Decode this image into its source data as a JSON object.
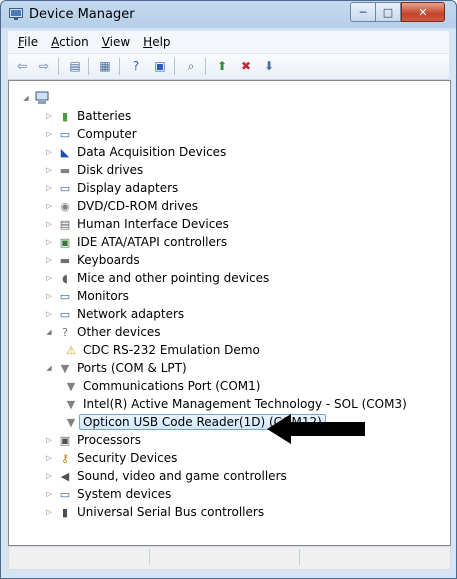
{
  "window": {
    "title": "Device Manager",
    "min": "─",
    "max": "□",
    "close": "✕"
  },
  "menu": [
    {
      "label": "File",
      "hotkey": "F",
      "rest": "ile"
    },
    {
      "label": "Action",
      "hotkey": "A",
      "rest": "ction"
    },
    {
      "label": "View",
      "hotkey": "V",
      "rest": "iew"
    },
    {
      "label": "Help",
      "hotkey": "H",
      "rest": "elp"
    }
  ],
  "toolbar": [
    {
      "name": "back-icon",
      "glyph": "⇦",
      "color": "#5b7aa0"
    },
    {
      "name": "forward-icon",
      "glyph": "⇨",
      "color": "#5b7aa0"
    },
    {
      "name": "show-hide-console-tree-icon",
      "glyph": "▤",
      "color": "#4a6e99"
    },
    {
      "name": "properties-icon",
      "glyph": "▦",
      "color": "#4a6e99"
    },
    {
      "name": "help-icon",
      "glyph": "?",
      "color": "#2b5fb0"
    },
    {
      "name": "help-topics-icon",
      "glyph": "▣",
      "color": "#2b5fb0"
    },
    {
      "name": "scan-hardware-changes-icon",
      "glyph": "⌕",
      "color": "#3d6aa6"
    },
    {
      "name": "update-driver-icon",
      "glyph": "⬆",
      "color": "#2e8b3a"
    },
    {
      "name": "uninstall-icon",
      "glyph": "✖",
      "color": "#c1272d"
    },
    {
      "name": "disable-device-icon",
      "glyph": "⬇",
      "color": "#4a6e99"
    }
  ],
  "tree": {
    "root": {
      "label": ""
    },
    "categories": [
      {
        "label": "Batteries",
        "icon": "battery-icon",
        "glyph": "▮",
        "color": "#4a9a3a"
      },
      {
        "label": "Computer",
        "icon": "computer-icon",
        "glyph": "▭",
        "color": "#2f5f9f"
      },
      {
        "label": "Data Acquisition Devices",
        "icon": "data-acquisition-icon",
        "glyph": "◣",
        "color": "#1a4fb0"
      },
      {
        "label": "Disk drives",
        "icon": "disk-drive-icon",
        "glyph": "▬",
        "color": "#808080"
      },
      {
        "label": "Display adapters",
        "icon": "display-adapter-icon",
        "glyph": "▭",
        "color": "#2f5f9f"
      },
      {
        "label": "DVD/CD-ROM drives",
        "icon": "dvd-drive-icon",
        "glyph": "◉",
        "color": "#808080"
      },
      {
        "label": "Human Interface Devices",
        "icon": "hid-icon",
        "glyph": "▤",
        "color": "#606060"
      },
      {
        "label": "IDE ATA/ATAPI controllers",
        "icon": "ide-controller-icon",
        "glyph": "▣",
        "color": "#3a7a3a"
      },
      {
        "label": "Keyboards",
        "icon": "keyboard-icon",
        "glyph": "▬",
        "color": "#707070"
      },
      {
        "label": "Mice and other pointing devices",
        "icon": "mouse-icon",
        "glyph": "◖",
        "color": "#606060"
      },
      {
        "label": "Monitors",
        "icon": "monitor-icon",
        "glyph": "▭",
        "color": "#2f5f9f"
      },
      {
        "label": "Network adapters",
        "icon": "network-adapter-icon",
        "glyph": "▭",
        "color": "#2f5f9f"
      },
      {
        "label": "Other devices",
        "icon": "other-devices-icon",
        "glyph": "?",
        "color": "#707070"
      },
      {
        "label": "CDC RS-232 Emulation Demo",
        "icon": "warning-device-icon",
        "glyph": "⚠",
        "color": "#d4a300"
      },
      {
        "label": "Ports (COM & LPT)",
        "icon": "port-icon",
        "glyph": "▼",
        "color": "#808080"
      },
      {
        "label": "Communications Port (COM1)",
        "icon": "com-port-icon",
        "glyph": "▼",
        "color": "#808080"
      },
      {
        "label": "Intel(R) Active Management Technology - SOL (COM3)",
        "icon": "com-port-icon",
        "glyph": "▼",
        "color": "#808080"
      },
      {
        "label": "Opticon USB Code Reader(1D) (COM12)",
        "icon": "com-port-icon",
        "glyph": "▼",
        "color": "#808080"
      },
      {
        "label": "Processors",
        "icon": "processor-icon",
        "glyph": "▣",
        "color": "#505050"
      },
      {
        "label": "Security Devices",
        "icon": "security-device-icon",
        "glyph": "⚷",
        "color": "#b08a20"
      },
      {
        "label": "Sound, video and game controllers",
        "icon": "sound-icon",
        "glyph": "◀",
        "color": "#505050"
      },
      {
        "label": "System devices",
        "icon": "system-devices-icon",
        "glyph": "▭",
        "color": "#2f5f9f"
      },
      {
        "label": "Universal Serial Bus controllers",
        "icon": "usb-icon",
        "glyph": "▮",
        "color": "#505050"
      }
    ]
  }
}
